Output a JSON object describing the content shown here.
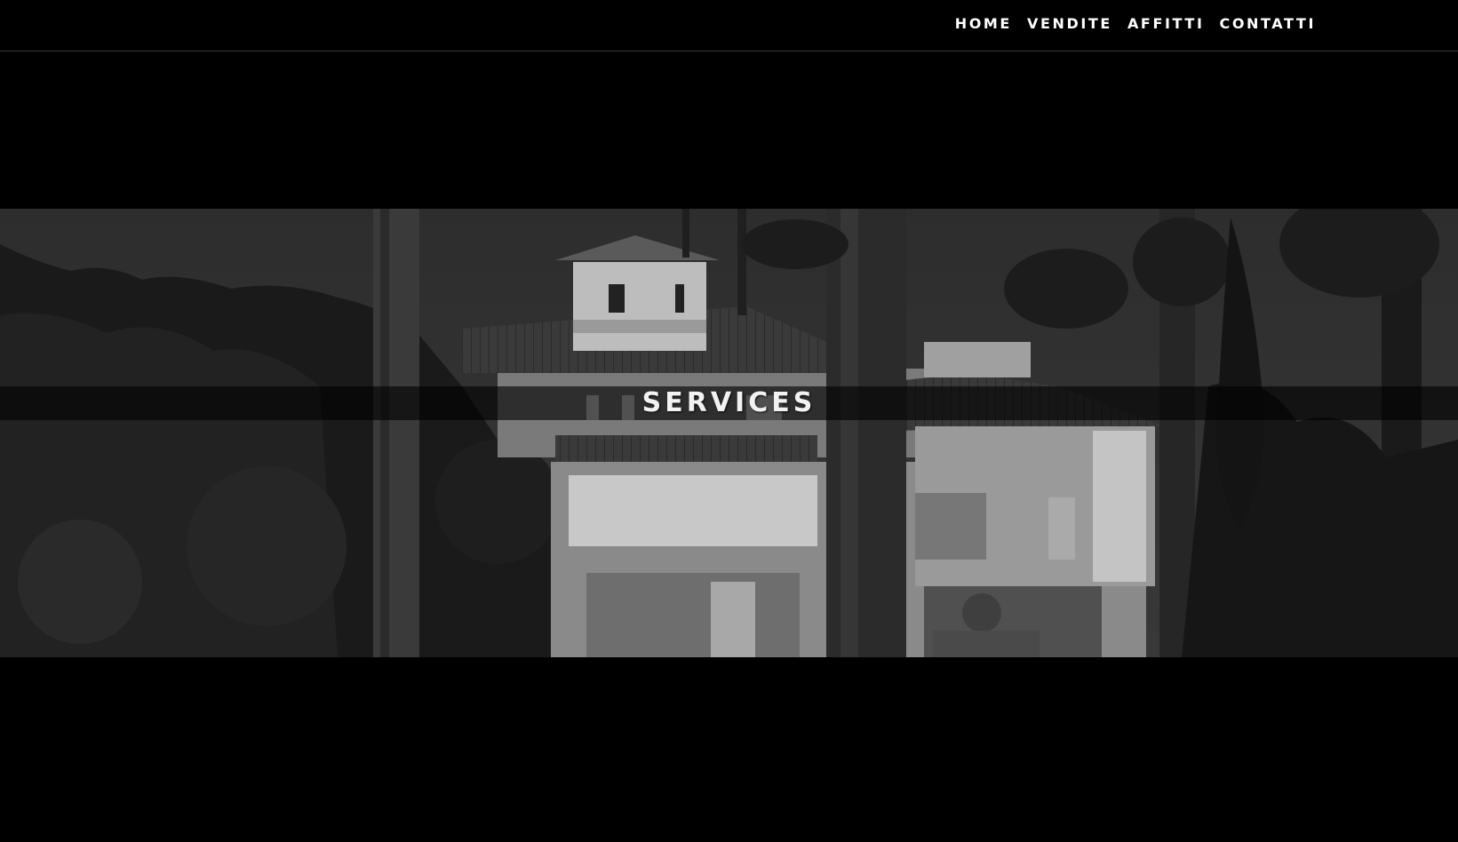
{
  "nav": {
    "items": [
      {
        "label": "HOME"
      },
      {
        "label": "VENDITE"
      },
      {
        "label": "AFFITTI"
      },
      {
        "label": "CONTATTI"
      }
    ]
  },
  "hero": {
    "title": "SERVICES",
    "image_icon": "villa-with-palm-trees-image"
  },
  "colors": {
    "background": "#000000",
    "nav_text": "#ffffff",
    "band": "#000000"
  }
}
